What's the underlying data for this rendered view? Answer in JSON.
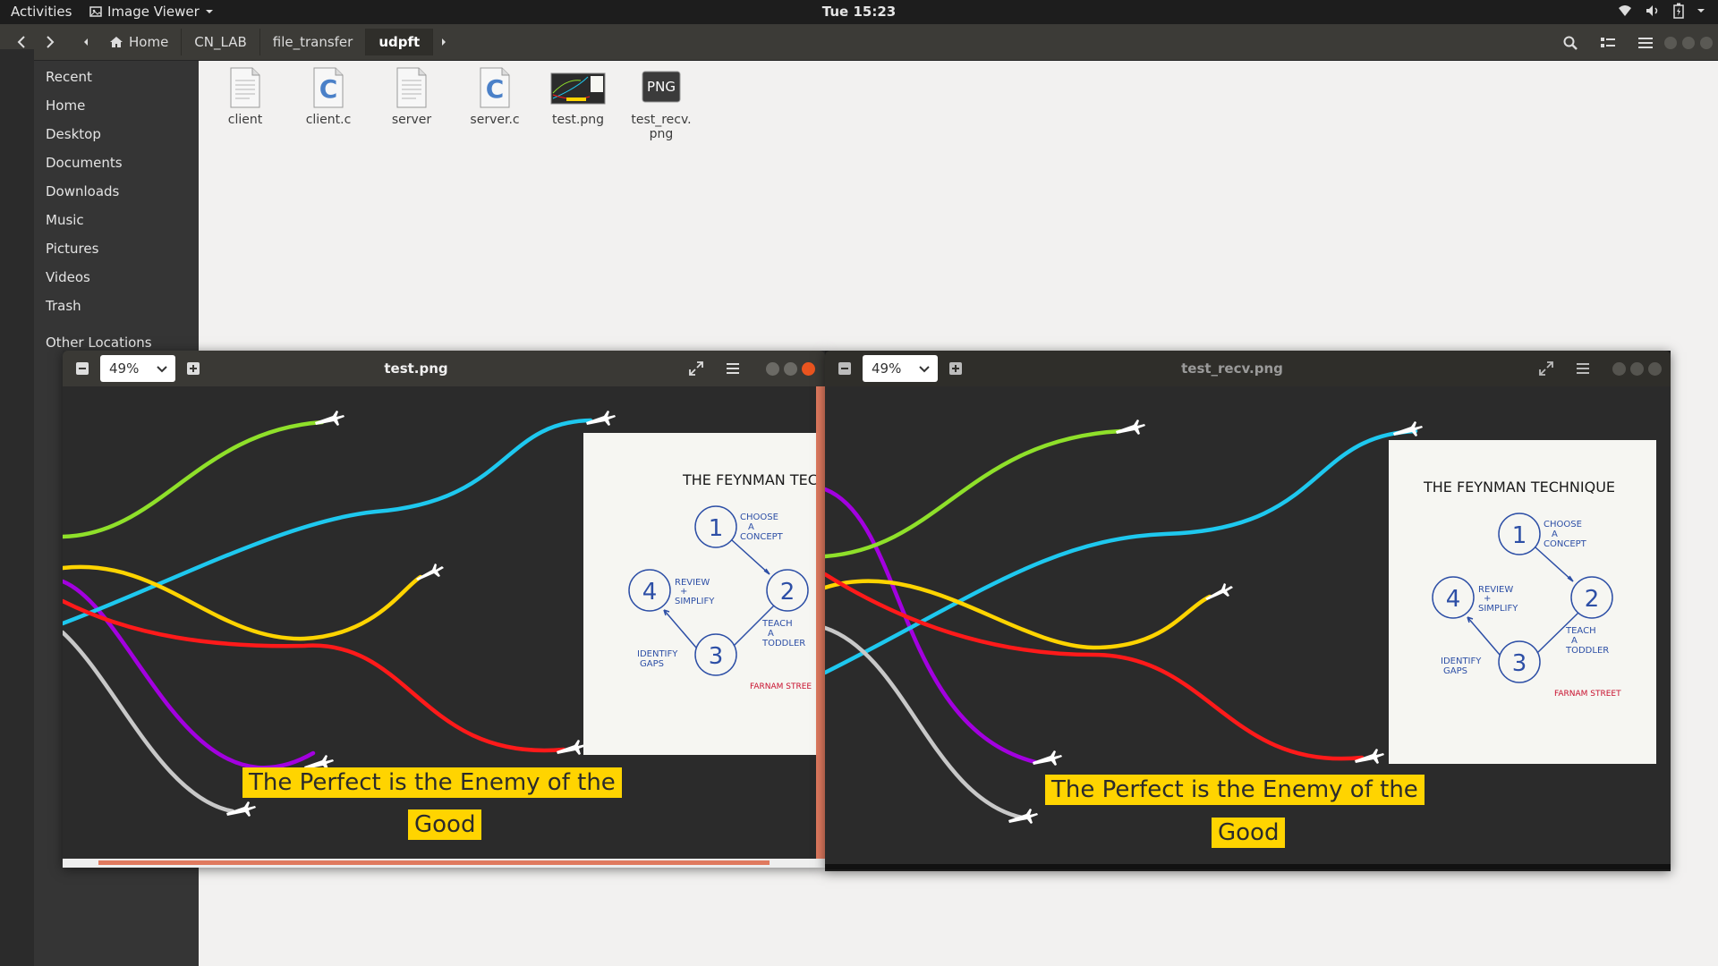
{
  "topbar": {
    "activities": "Activities",
    "app_name": "Image Viewer",
    "clock": "Tue 15:23",
    "icons": [
      "wifi-icon",
      "volume-icon",
      "battery-icon",
      "power-icon"
    ]
  },
  "files": {
    "breadcrumbs": [
      {
        "label": "Home",
        "icon": "home-icon"
      },
      {
        "label": "CN_LAB"
      },
      {
        "label": "file_transfer"
      },
      {
        "label": "udpft"
      }
    ],
    "sidebar": [
      {
        "label": "Recent",
        "icon": "clock-icon"
      },
      {
        "label": "Home",
        "icon": "home-icon"
      },
      {
        "label": "Desktop",
        "icon": "folder-icon"
      },
      {
        "label": "Documents",
        "icon": "document-icon"
      },
      {
        "label": "Downloads",
        "icon": "download-icon"
      },
      {
        "label": "Music",
        "icon": "music-icon"
      },
      {
        "label": "Pictures",
        "icon": "camera-icon"
      },
      {
        "label": "Videos",
        "icon": "video-icon"
      },
      {
        "label": "Trash",
        "icon": "trash-icon"
      },
      {
        "label": "Other Locations",
        "icon": "plus-icon"
      }
    ],
    "items": [
      {
        "name": "client",
        "type": "binary"
      },
      {
        "name": "client.c",
        "type": "c-source"
      },
      {
        "name": "server",
        "type": "binary"
      },
      {
        "name": "server.c",
        "type": "c-source"
      },
      {
        "name": "test.png",
        "type": "image"
      },
      {
        "name": "test_recv.\npng",
        "type": "png"
      }
    ],
    "png_badge": "PNG"
  },
  "viewers": [
    {
      "title": "test.png",
      "zoom": "49%",
      "quote_line1": "The Perfect is the Enemy of the",
      "quote_line2": "Good",
      "card": {
        "title": "The Feynman Technique",
        "steps": [
          "1",
          "2",
          "3",
          "4"
        ],
        "step_labels": [
          "Choose a Concept",
          "Teach a Toddler",
          "Identify Gaps",
          "Review + Simplify"
        ],
        "credit": "Farnam Stree"
      }
    },
    {
      "title": "test_recv.png",
      "zoom": "49%",
      "quote_line1": "The Perfect is the Enemy of the",
      "quote_line2": "Good",
      "card": {
        "title": "The Feynman Technique",
        "steps": [
          "1",
          "2",
          "3",
          "4"
        ],
        "step_labels": [
          "Choose a Concept",
          "Teach a Toddler",
          "Identify Gaps",
          "Review + Simplify"
        ],
        "credit": "Farnam Street"
      }
    }
  ],
  "colors": {
    "accent_close": "#e9541f",
    "line_green": "#8fe02a",
    "line_cyan": "#1ec8ef",
    "line_yellow": "#ffd400",
    "line_red": "#ff1a1a",
    "line_purple": "#b000e8",
    "line_grey": "#c8c8c8",
    "quote_bg": "#ffd400"
  }
}
